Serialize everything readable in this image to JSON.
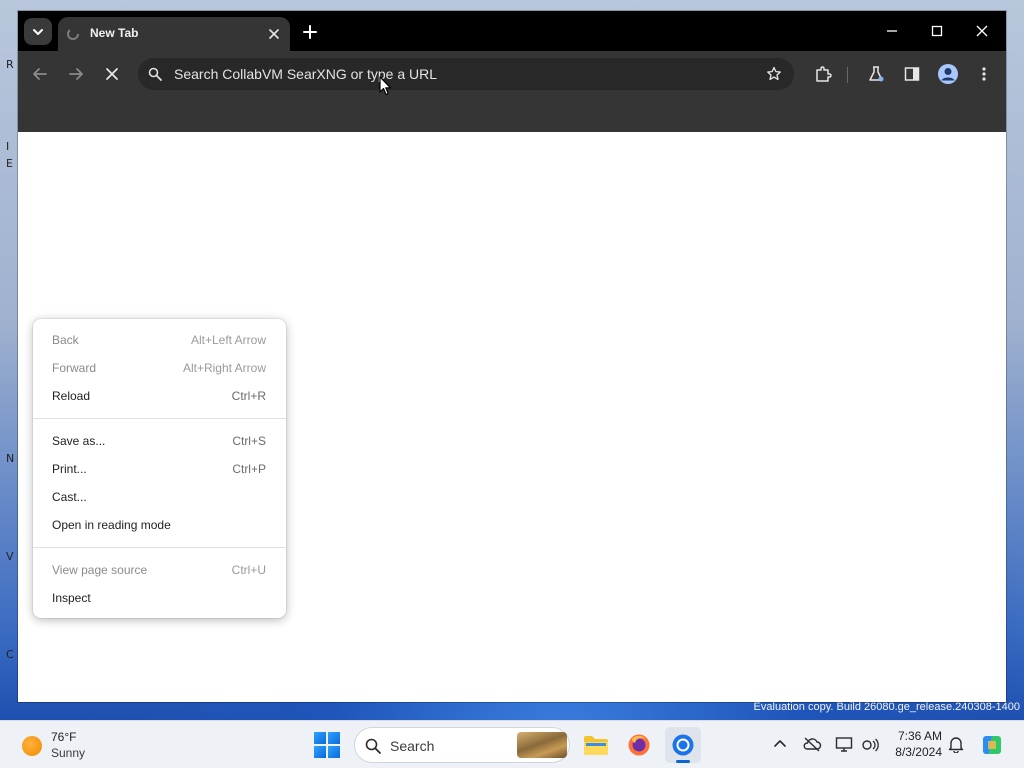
{
  "browser": {
    "tab": {
      "title": "New Tab"
    },
    "omnibox": {
      "placeholder": "Search CollabVM SearXNG or type a URL"
    }
  },
  "context_menu": {
    "groups": [
      [
        {
          "label": "Back",
          "shortcut": "Alt+Left Arrow",
          "enabled": false
        },
        {
          "label": "Forward",
          "shortcut": "Alt+Right Arrow",
          "enabled": false
        },
        {
          "label": "Reload",
          "shortcut": "Ctrl+R",
          "enabled": true
        }
      ],
      [
        {
          "label": "Save as...",
          "shortcut": "Ctrl+S",
          "enabled": true
        },
        {
          "label": "Print...",
          "shortcut": "Ctrl+P",
          "enabled": true
        },
        {
          "label": "Cast...",
          "shortcut": "",
          "enabled": true
        },
        {
          "label": "Open in reading mode",
          "shortcut": "",
          "enabled": true
        }
      ],
      [
        {
          "label": "View page source",
          "shortcut": "Ctrl+U",
          "enabled": false
        },
        {
          "label": "Inspect",
          "shortcut": "",
          "enabled": true
        }
      ]
    ]
  },
  "desktop": {
    "watermark": {
      "line1": "Evaluation copy. Build 26080.ge_release.240308-1400",
      "line2": ""
    }
  },
  "taskbar": {
    "weather": {
      "temp": "76°F",
      "condition": "Sunny"
    },
    "search_label": "Search",
    "clock": {
      "time": "7:36 AM",
      "date": "8/3/2024"
    }
  },
  "colors": {
    "browser_frame": "#000000",
    "toolbar": "#353535",
    "omnibox": "#282828",
    "accent": "#0a64d6"
  }
}
